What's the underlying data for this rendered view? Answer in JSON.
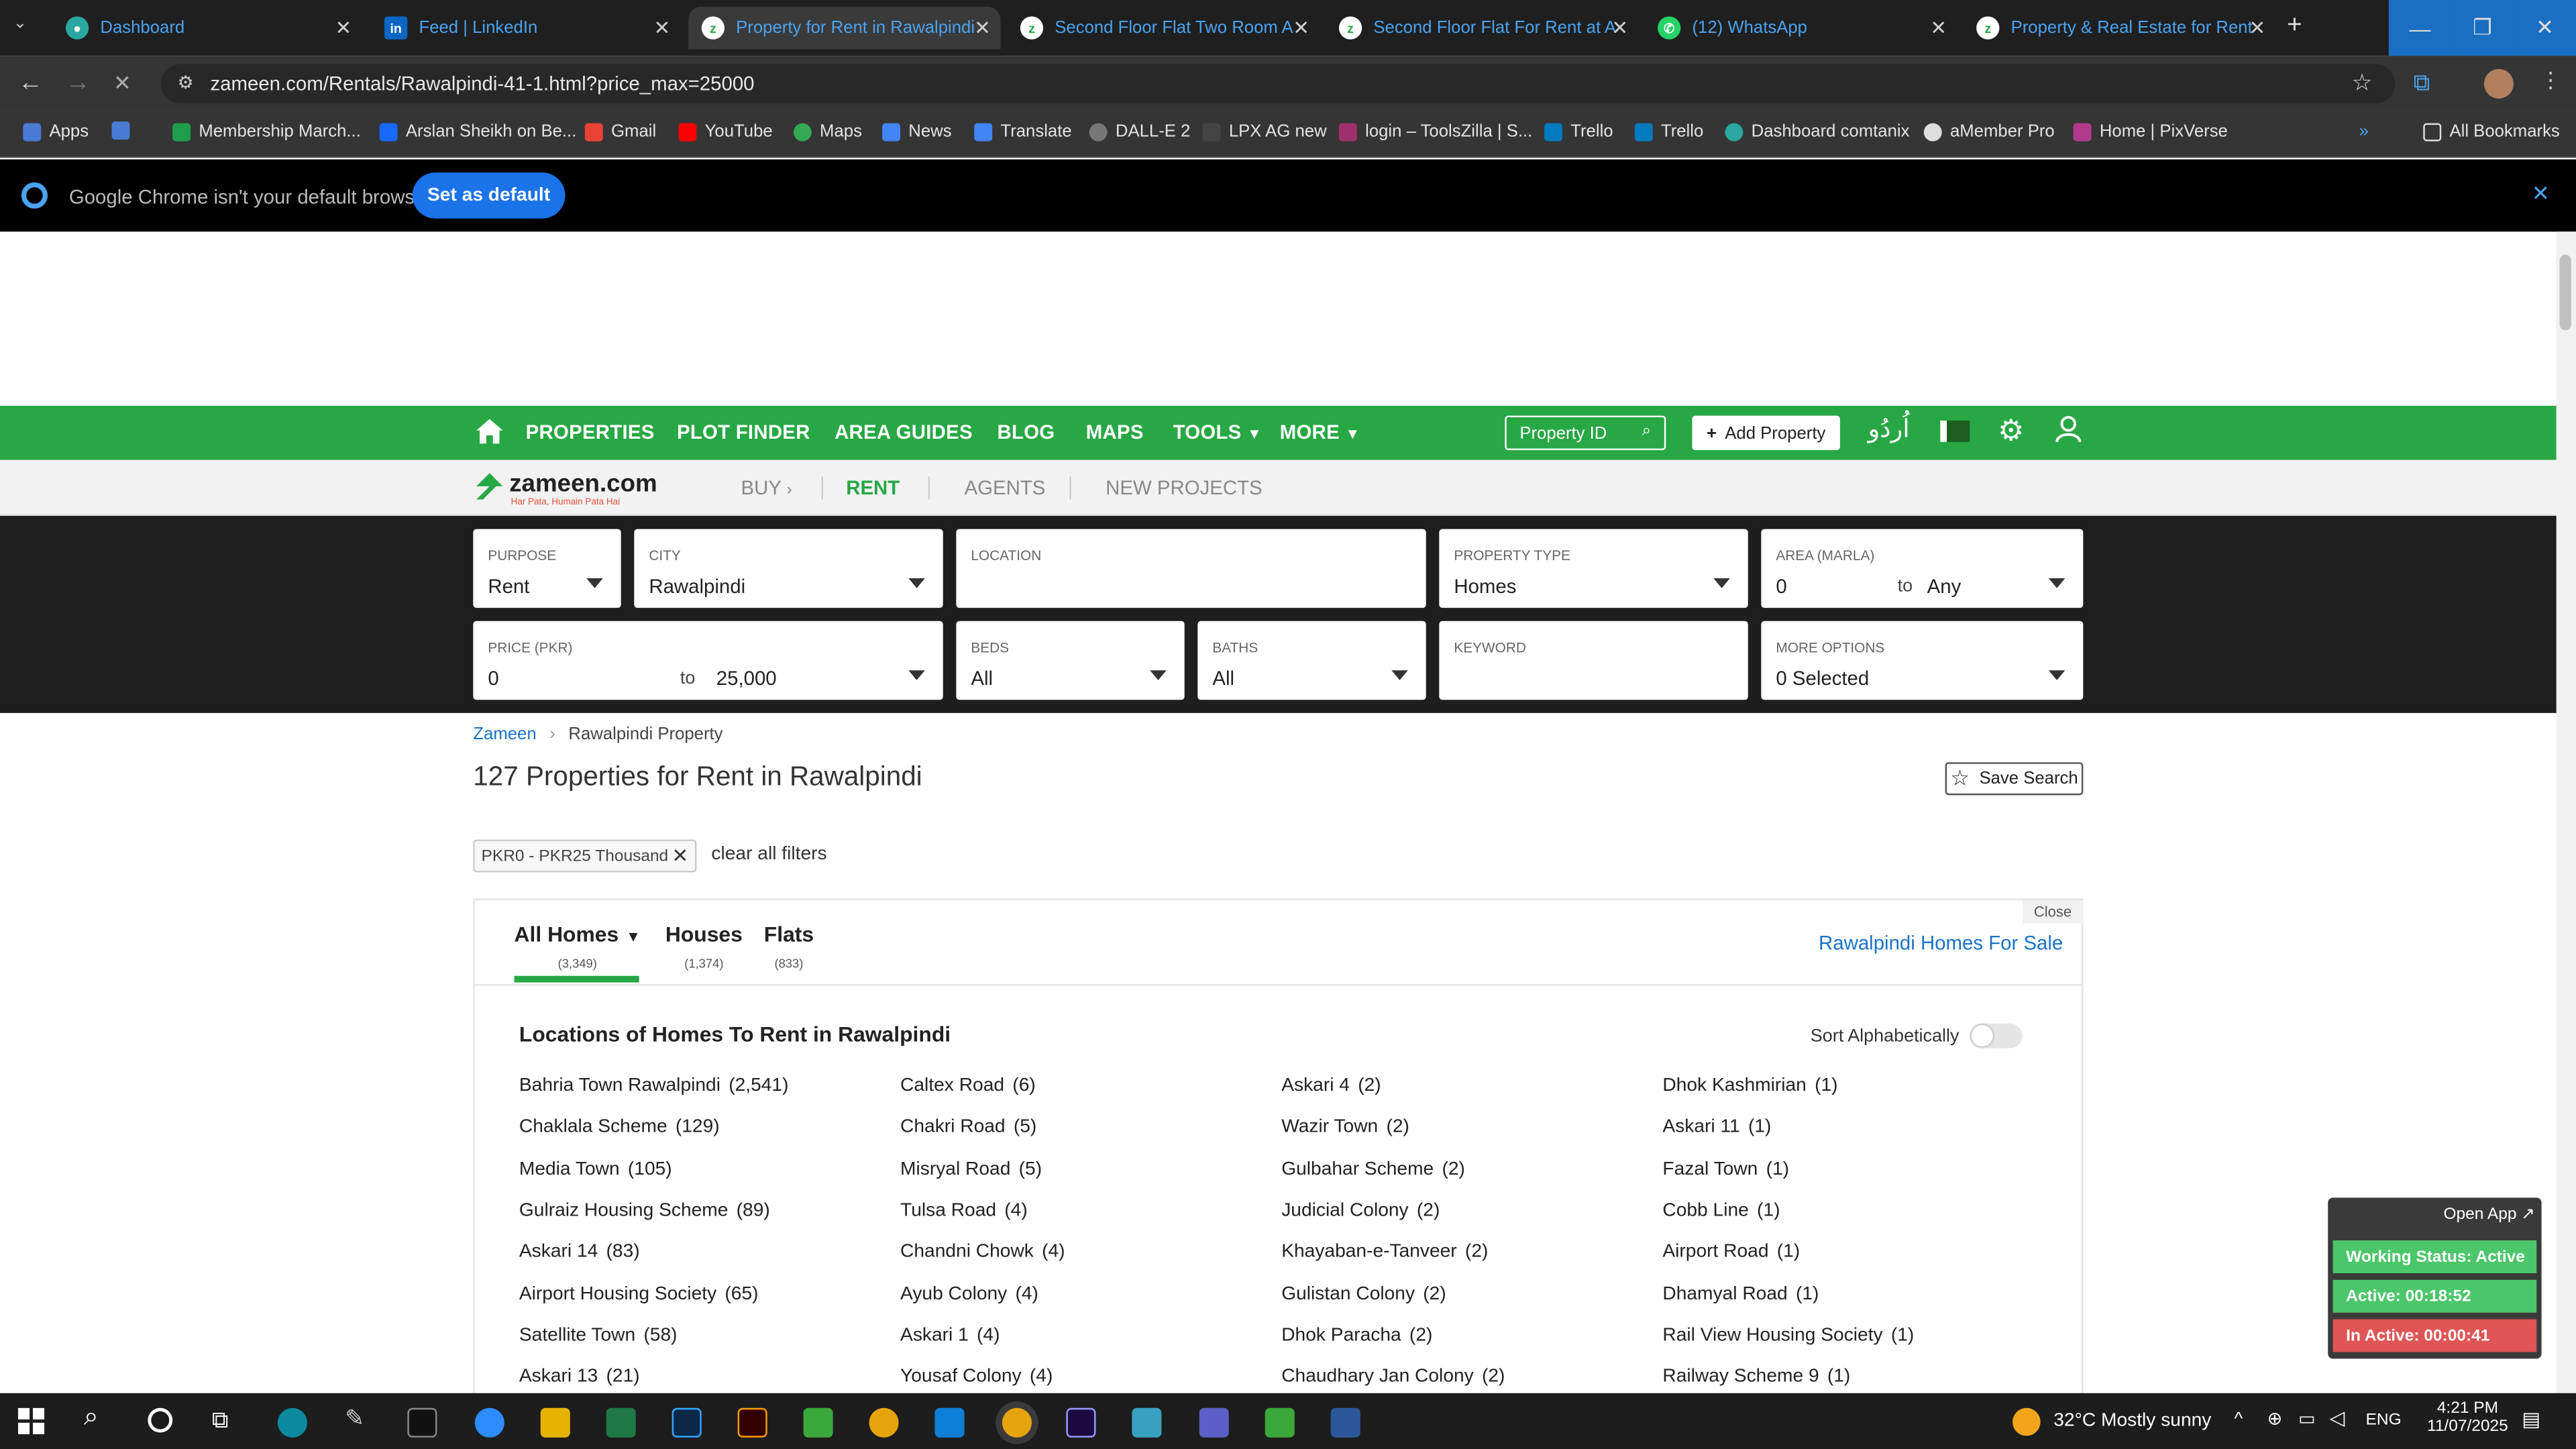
{
  "browser": {
    "tabs": [
      {
        "title": "Dashboard",
        "icon": "dashboard-icon"
      },
      {
        "title": "Feed | LinkedIn",
        "icon": "linkedin-icon"
      },
      {
        "title": "Property for Rent in Rawalpindi",
        "icon": "zameen-icon"
      },
      {
        "title": "Second Floor Flat Two Room A",
        "icon": "zameen-icon"
      },
      {
        "title": "Second Floor Flat For Rent at A",
        "icon": "zameen-icon"
      },
      {
        "title": "(12) WhatsApp",
        "icon": "whatsapp-icon"
      },
      {
        "title": "Property & Real Estate for Rent",
        "icon": "zameen-icon"
      }
    ],
    "url": "zameen.com/Rentals/Rawalpindi-41-1.html?price_max=25000",
    "bookmarks": [
      "Apps",
      "Membership March...",
      "Arslan Sheikh on Be...",
      "Gmail",
      "YouTube",
      "Maps",
      "News",
      "Translate",
      "DALL-E 2",
      "LPX AG new",
      "login – ToolsZilla | S...",
      "Trello",
      "Trello",
      "Dashboard comtanix",
      "aMember Pro",
      "Home | PixVerse"
    ],
    "all_bookmarks": "All Bookmarks",
    "default_msg": "Google Chrome isn't your default browser",
    "set_default": "Set as default"
  },
  "header": {
    "nav": [
      "PROPERTIES",
      "PLOT FINDER",
      "AREA GUIDES",
      "BLOG",
      "MAPS",
      "TOOLS",
      "MORE"
    ],
    "property_id_placeholder": "Property ID",
    "add_property": "Add Property",
    "urdu": "اُردُو",
    "logo": "zameen.com",
    "tagline": "Har Pata, Humain Pata Hai",
    "subnav": [
      "BUY",
      "RENT",
      "AGENTS",
      "NEW PROJECTS"
    ]
  },
  "search": {
    "purpose_label": "PURPOSE",
    "purpose": "Rent",
    "city_label": "CITY",
    "city": "Rawalpindi",
    "location_label": "LOCATION",
    "ptype_label": "PROPERTY TYPE",
    "ptype": "Homes",
    "area_label": "AREA (MARLA)",
    "area_min": "0",
    "area_to": "to",
    "area_max": "Any",
    "price_label": "PRICE (PKR)",
    "price_min": "0",
    "price_to": "to",
    "price_max": "25,000",
    "beds_label": "BEDS",
    "beds": "All",
    "baths_label": "BATHS",
    "baths": "All",
    "keyword_label": "KEYWORD",
    "more_label": "MORE OPTIONS",
    "more": "0 Selected"
  },
  "breadcrumb": {
    "root": "Zameen",
    "current": "Rawalpindi Property"
  },
  "results_title": "127 Properties for Rent in Rawalpindi",
  "save_search": "Save Search",
  "filter_chip": "PKR0 - PKR25 Thousand",
  "clear_filters": "clear all filters",
  "panel": {
    "close": "Close",
    "tabs": [
      {
        "label": "All Homes",
        "count": "(3,349)"
      },
      {
        "label": "Houses",
        "count": "(1,374)"
      },
      {
        "label": "Flats",
        "count": "(833)"
      }
    ],
    "for_sale_link": "Rawalpindi Homes For Sale",
    "heading": "Locations of Homes To Rent in Rawalpindi",
    "sort_label": "Sort Alphabetically",
    "locations": [
      [
        "Bahria Town Rawalpindi",
        "(2,541)",
        "Caltex Road",
        "(6)",
        "Askari 4",
        "(2)",
        "Dhok Kashmirian",
        "(1)"
      ],
      [
        "Chaklala Scheme",
        "(129)",
        "Chakri Road",
        "(5)",
        "Wazir Town",
        "(2)",
        "Askari 11",
        "(1)"
      ],
      [
        "Media Town",
        "(105)",
        "Misryal Road",
        "(5)",
        "Gulbahar Scheme",
        "(2)",
        "Fazal Town",
        "(1)"
      ],
      [
        "Gulraiz Housing Scheme",
        "(89)",
        "Tulsa Road",
        "(4)",
        "Judicial Colony",
        "(2)",
        "Cobb Line",
        "(1)"
      ],
      [
        "Askari 14",
        "(83)",
        "Chandni Chowk",
        "(4)",
        "Khayaban-e-Tanveer",
        "(2)",
        "Airport Road",
        "(1)"
      ],
      [
        "Airport Housing Society",
        "(65)",
        "Ayub Colony",
        "(4)",
        "Gulistan Colony",
        "(2)",
        "Dhamyal Road",
        "(1)"
      ],
      [
        "Satellite Town",
        "(58)",
        "Askari 1",
        "(4)",
        "Dhok Paracha",
        "(2)",
        "Rail View Housing Society",
        "(1)"
      ],
      [
        "Askari 13",
        "(21)",
        "Yousaf Colony",
        "(4)",
        "Chaudhary Jan Colony",
        "(2)",
        "Railway Scheme 9",
        "(1)"
      ]
    ]
  },
  "widget": {
    "open_app": "Open App",
    "status": "Working Status: Active",
    "active": "Active: 00:18:52",
    "inactive": "In Active: 00:00:41"
  },
  "taskbar": {
    "weather": "32°C  Mostly sunny",
    "lang": "ENG",
    "time": "4:21 PM",
    "date": "11/07/2025"
  },
  "colors": {
    "brand_green": "#28a745",
    "link_blue": "#1a73c8",
    "status_green": "#4cc66a",
    "inactive_red": "#e05555"
  }
}
